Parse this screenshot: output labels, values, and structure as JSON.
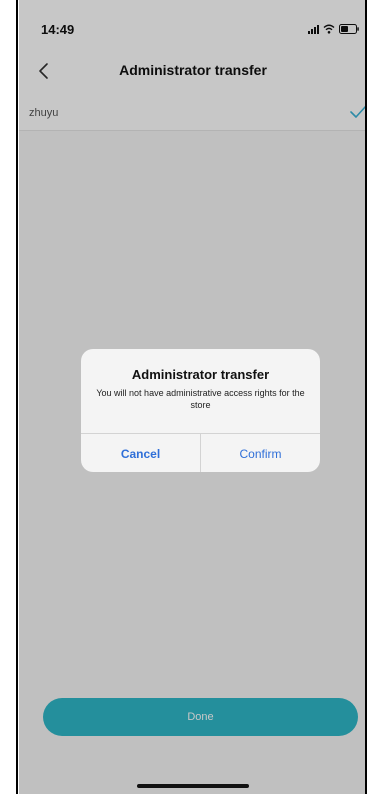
{
  "status_bar": {
    "time": "14:49",
    "icons": [
      "signal-icon",
      "wifi-icon",
      "battery-icon"
    ]
  },
  "nav": {
    "back_icon": "chevron-left-icon",
    "title": "Administrator transfer"
  },
  "list": {
    "items": [
      {
        "label": "zhuyu",
        "selected": true,
        "icon": "check-icon"
      }
    ]
  },
  "dialog": {
    "title": "Administrator transfer",
    "message": "You will not have administrative access rights for the store",
    "cancel_label": "Cancel",
    "confirm_label": "Confirm"
  },
  "footer": {
    "done_label": "Done"
  },
  "colors": {
    "accent": "#2fb8c8",
    "dialog_button": "#2f6fd8",
    "check": "#3ab3d6"
  }
}
